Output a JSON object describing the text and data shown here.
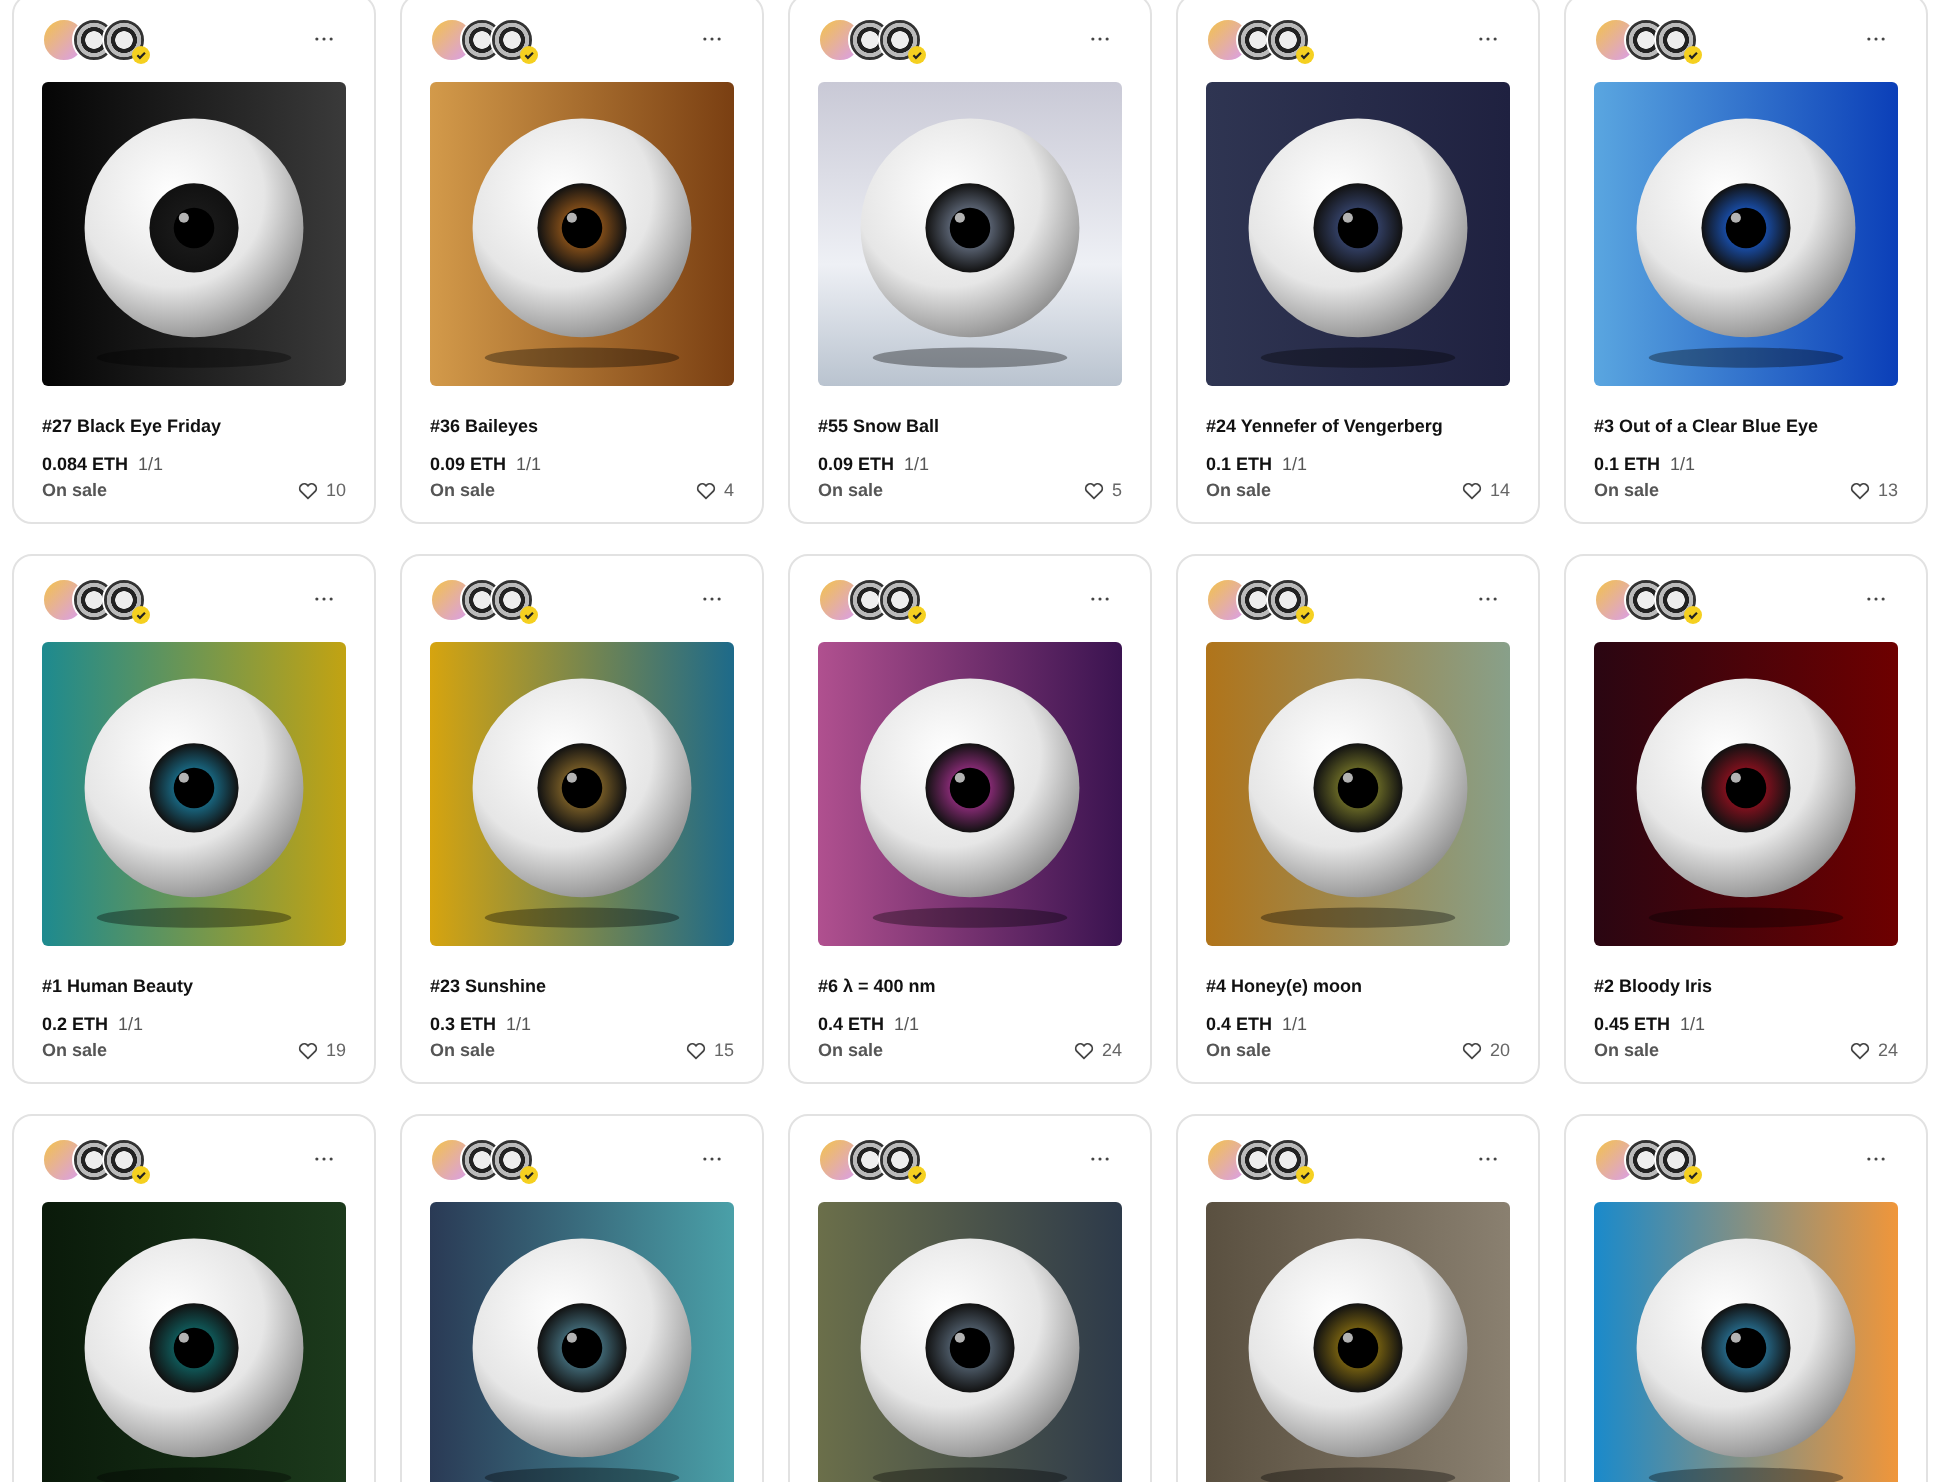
{
  "cards": [
    {
      "verified": true,
      "title": "#27 Black Eye Friday",
      "price": "0.084 ETH",
      "edition": "1/1",
      "status": "On sale",
      "likes": "10"
    },
    {
      "verified": true,
      "title": "#36 Baileyes",
      "price": "0.09 ETH",
      "edition": "1/1",
      "status": "On sale",
      "likes": "4"
    },
    {
      "verified": true,
      "title": "#55 Snow Ball",
      "price": "0.09 ETH",
      "edition": "1/1",
      "status": "On sale",
      "likes": "5"
    },
    {
      "verified": true,
      "title": "#24 Yennefer of Vengerberg",
      "price": "0.1 ETH",
      "edition": "1/1",
      "status": "On sale",
      "likes": "14"
    },
    {
      "verified": true,
      "title": "#3 Out of a Clear Blue Eye",
      "price": "0.1 ETH",
      "edition": "1/1",
      "status": "On sale",
      "likes": "13"
    },
    {
      "verified": true,
      "title": "#1 Human Beauty",
      "price": "0.2 ETH",
      "edition": "1/1",
      "status": "On sale",
      "likes": "19"
    },
    {
      "verified": true,
      "title": "#23 Sunshine",
      "price": "0.3 ETH",
      "edition": "1/1",
      "status": "On sale",
      "likes": "15"
    },
    {
      "verified": true,
      "title": "#6 λ = 400 nm",
      "price": "0.4 ETH",
      "edition": "1/1",
      "status": "On sale",
      "likes": "24"
    },
    {
      "verified": true,
      "title": "#4 Honey(e) moon",
      "price": "0.4 ETH",
      "edition": "1/1",
      "status": "On sale",
      "likes": "20"
    },
    {
      "verified": true,
      "title": "#2 Bloody Iris",
      "price": "0.45 ETH",
      "edition": "1/1",
      "status": "On sale",
      "likes": "24"
    },
    {
      "verified": true
    },
    {
      "verified": true
    },
    {
      "verified": true
    },
    {
      "verified": true
    },
    {
      "verified": true
    }
  ]
}
